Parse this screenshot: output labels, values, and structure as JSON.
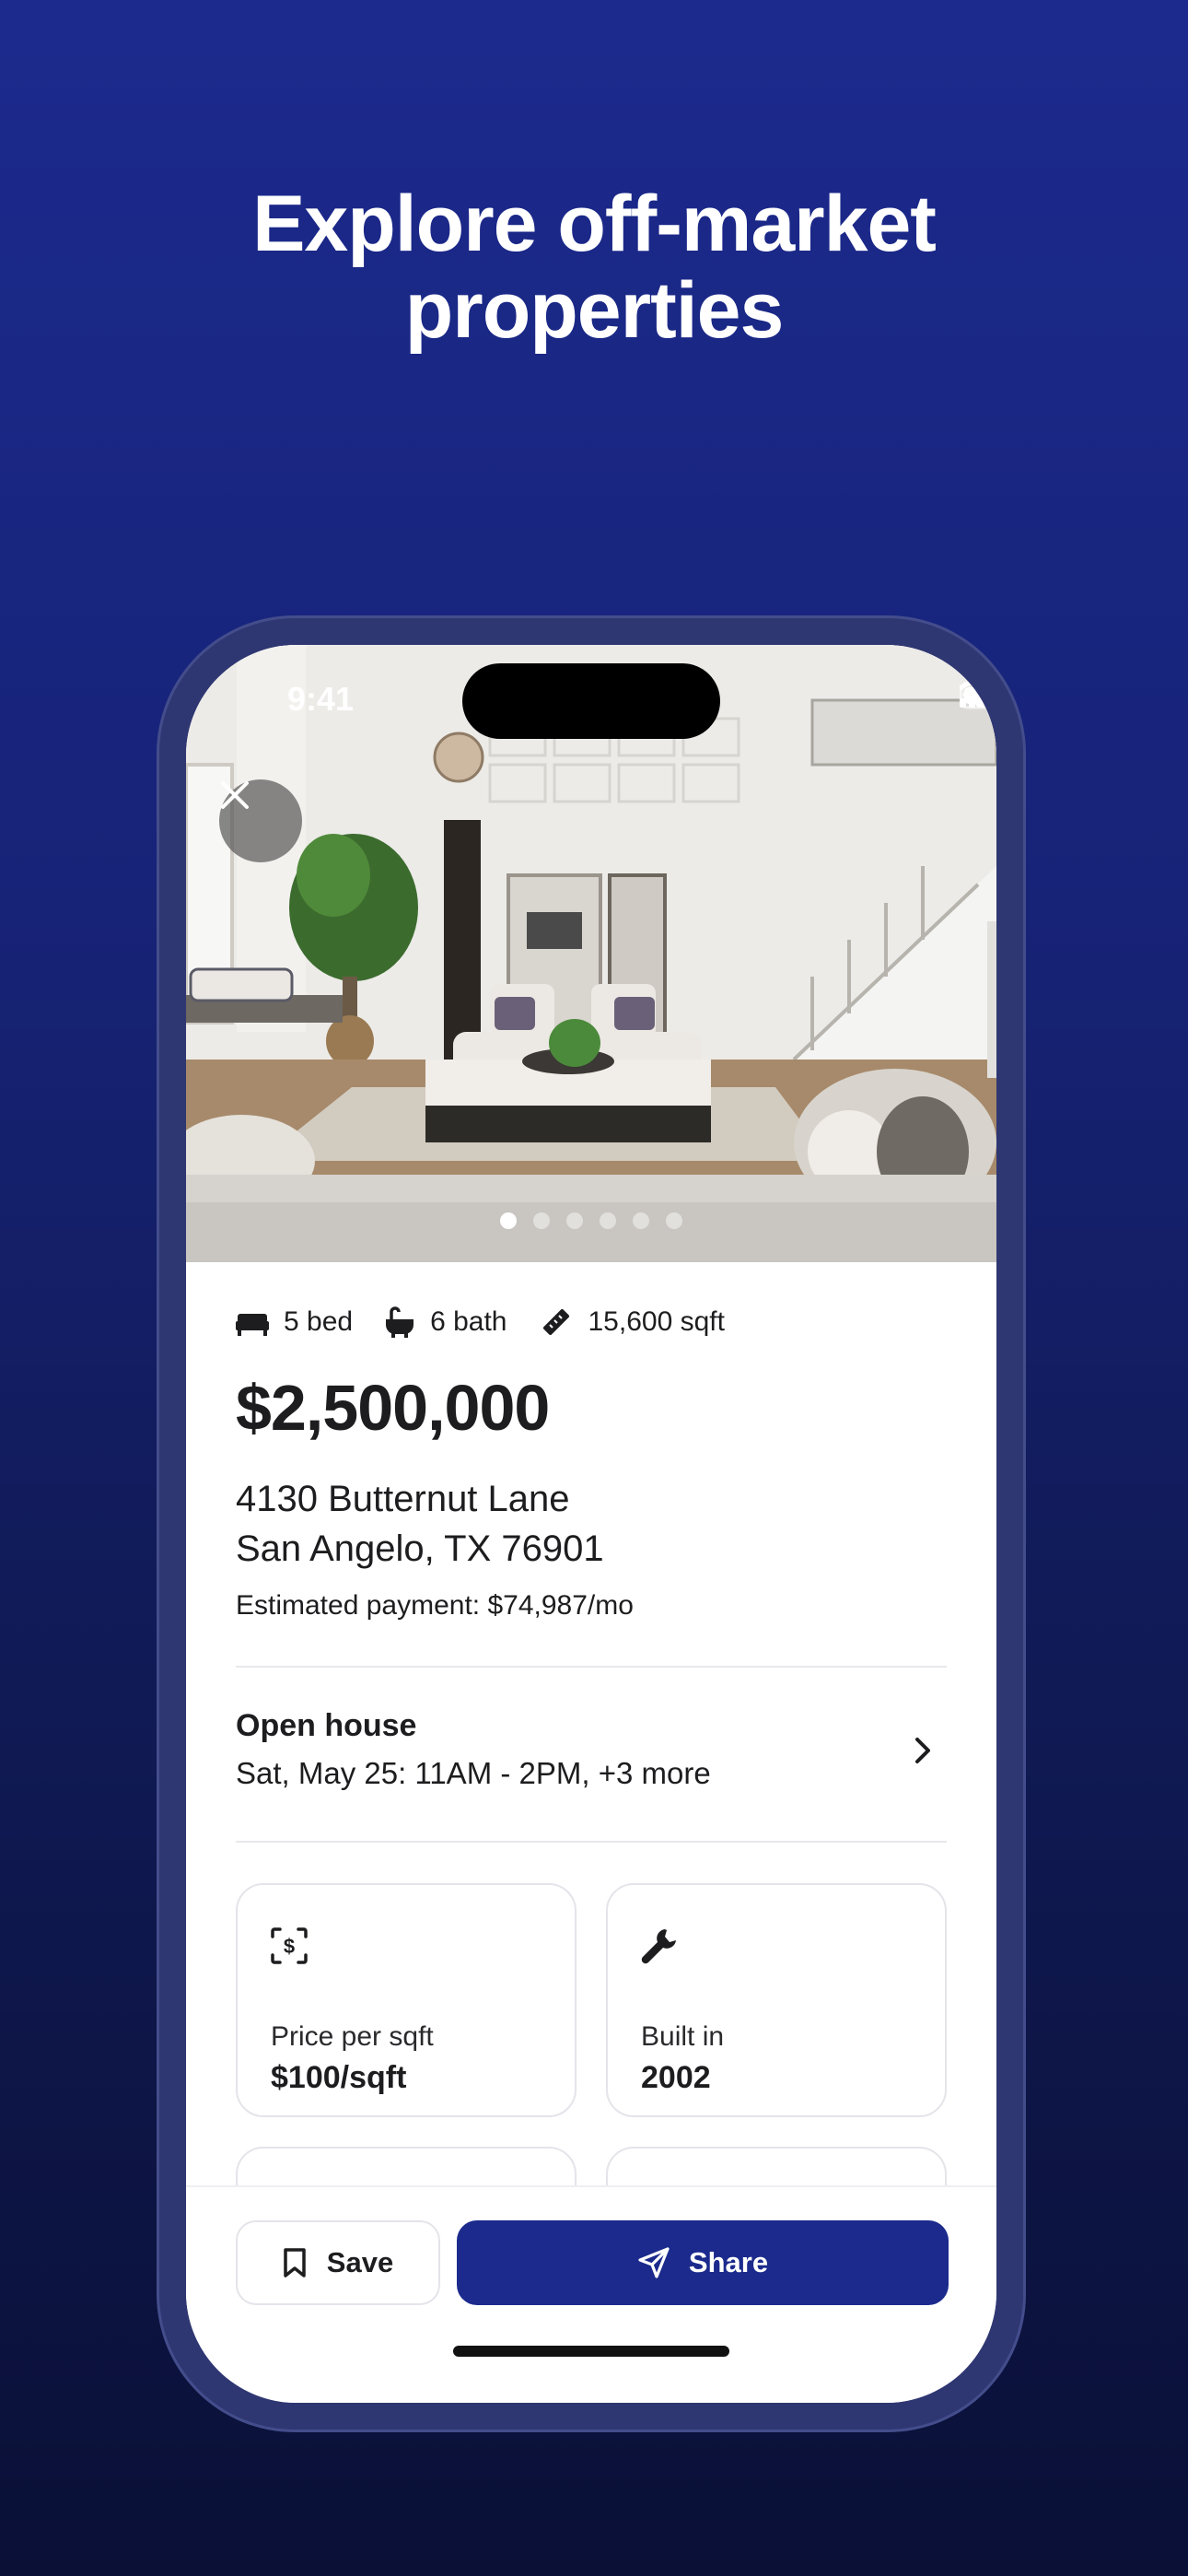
{
  "headline": {
    "line1": "Explore off-market",
    "line2": "properties"
  },
  "status_bar": {
    "time": "9:41",
    "icons": [
      "signal-icon",
      "wifi-icon",
      "battery-icon"
    ]
  },
  "gallery": {
    "photo_count": 6,
    "active_index": 0,
    "close_icon": "close-icon"
  },
  "listing": {
    "beds": "5 bed",
    "baths": "6 bath",
    "sqft": "15,600 sqft",
    "price": "$2,500,000",
    "address_line1": "4130 Butternut Lane",
    "address_line2": "San Angelo, TX 76901",
    "estimated_payment": "Estimated payment: $74,987/mo"
  },
  "open_house": {
    "title": "Open house",
    "detail": "Sat, May 25: 11AM - 2PM, +3 more"
  },
  "facts": [
    {
      "icon": "dollar-tag-icon",
      "label": "Price per sqft",
      "value": "$100/sqft"
    },
    {
      "icon": "wrench-icon",
      "label": "Built in",
      "value": "2002"
    }
  ],
  "actions": {
    "save_label": "Save",
    "share_label": "Share"
  },
  "colors": {
    "brand": "#1b2a8c",
    "background_top": "#1c2a8e",
    "background_bottom": "#0a1036"
  }
}
